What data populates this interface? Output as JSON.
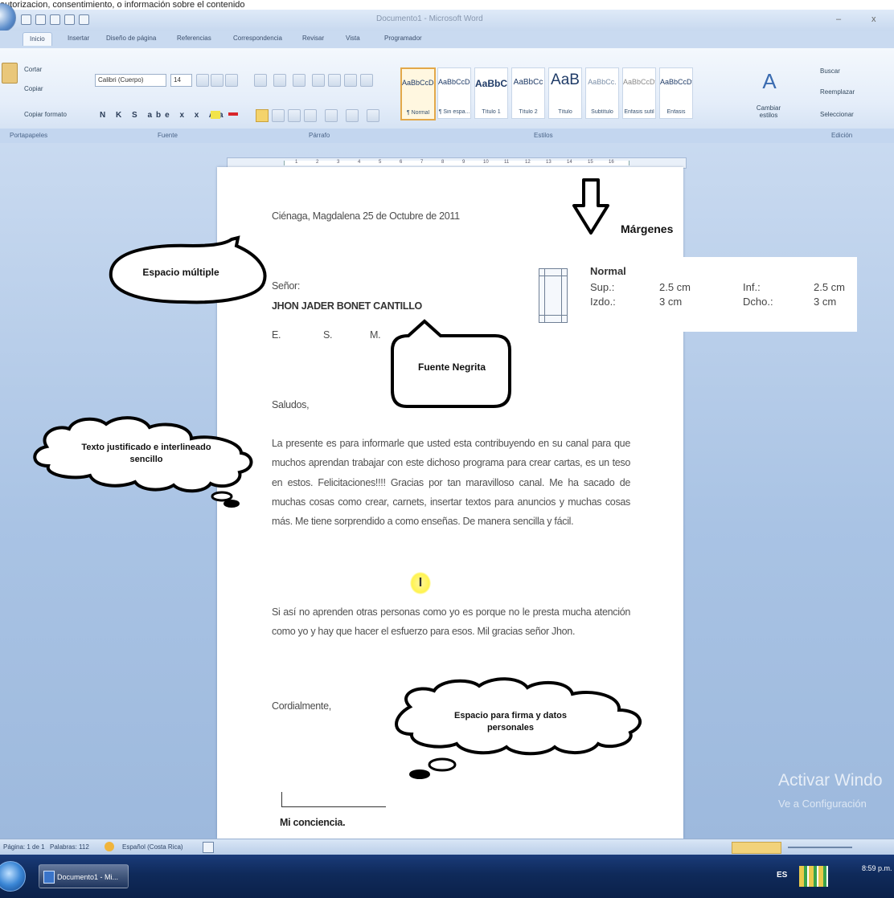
{
  "top_strip": "autorizacion, consentimiento, o información sobre el contenido",
  "window": {
    "title": "Documento1 - Microsoft Word",
    "min": "–",
    "close": "x"
  },
  "tabs": [
    "Inicio",
    "Insertar",
    "Diseño de página",
    "Referencias",
    "Correspondencia",
    "Revisar",
    "Vista",
    "Programador"
  ],
  "ribbon": {
    "clipboard": {
      "cut": "Cortar",
      "copy": "Copiar",
      "format_painter": "Copiar formato"
    },
    "font_name": "Calibri (Cuerpo)",
    "font_size": "14",
    "styles": [
      {
        "sample": "AaBbCcDc",
        "name": "¶ Normal",
        "selected": true
      },
      {
        "sample": "AaBbCcDc",
        "name": "¶ Sin espa..."
      },
      {
        "sample": "AaBbC",
        "name": "Título 1"
      },
      {
        "sample": "AaBbCc",
        "name": "Título 2"
      },
      {
        "sample": "AaB",
        "name": "Título"
      },
      {
        "sample": "AaBbCc.",
        "name": "Subtítulo"
      },
      {
        "sample": "AaBbCcDt",
        "name": "Énfasis sutil"
      },
      {
        "sample": "AaBbCcDt",
        "name": "Énfasis"
      }
    ],
    "change_styles": "Cambiar estilos",
    "edit": {
      "find": "Buscar",
      "replace": "Reemplazar",
      "select": "Seleccionar"
    }
  },
  "group_labels": [
    "Portapapeles",
    "Fuente",
    "Párrafo",
    "Estilos",
    "Edición"
  ],
  "ruler_numbers": [
    "1",
    "2",
    "3",
    "4",
    "5",
    "6",
    "7",
    "8",
    "9",
    "10",
    "11",
    "12",
    "13",
    "14",
    "15",
    "16"
  ],
  "letter": {
    "date": "Ciénaga, Magdalena  25 de Octubre de 2011",
    "salutation_to": "Señor:",
    "recipient": "JHON JADER BONET CANTILLO",
    "esm": [
      "E.",
      "S.",
      "M."
    ],
    "greeting": "Saludos,",
    "paragraph1": "La presente es para informarle que usted esta contribuyendo en su canal para que muchos aprendan trabajar con este dichoso programa para crear cartas, es un teso en estos. Felicitaciones!!!! Gracias por tan maravilloso canal. Me ha sacado de muchas cosas como crear, carnets, insertar textos para anuncios y muchas cosas más. Me tiene sorprendido a como enseñas. De manera sencilla y fácil.",
    "paragraph2": "Si así no aprenden otras personas como yo es porque no le presta mucha atención como yo y hay que hacer el esfuerzo para esos. Mil gracias señor Jhon.",
    "closing": "Cordialmente,",
    "signature": "Mi conciencia."
  },
  "annotations": {
    "espacio_multiple": "Espacio múltiple",
    "fuente_negrita": "Fuente Negrita",
    "texto_justificado": "Texto justificado e interlineado sencillo",
    "espacio_firma": "Espacio para firma y datos personales",
    "margenes": "Márgenes"
  },
  "margins": {
    "name": "Normal",
    "sup_label": "Sup.:",
    "sup_value": "2.5 cm",
    "inf_label": "Inf.:",
    "inf_value": "2.5 cm",
    "izdo_label": "Izdo.:",
    "izdo_value": "3 cm",
    "dcho_label": "Dcho.:",
    "dcho_value": "3 cm"
  },
  "statusbar": {
    "page": "Página: 1 de 1",
    "words": "Palabras: 112",
    "language": "Español (Costa Rica)"
  },
  "watermark": {
    "line1": "Activar Windo",
    "line2": "Ve a Configuración"
  },
  "taskbar": {
    "word_button": "Documento1 - Mi...",
    "lang": "ES",
    "time": "8:59 p.m."
  }
}
